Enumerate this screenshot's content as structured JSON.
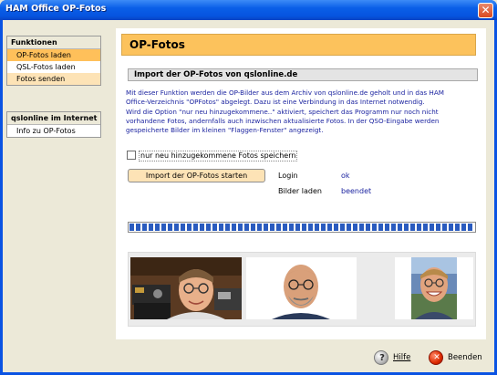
{
  "window": {
    "title": "HAM Office OP-Fotos",
    "close_glyph": "✕"
  },
  "sidebar": {
    "sections": [
      {
        "header": "Funktionen",
        "items": [
          {
            "label": "OP-Fotos laden",
            "active": true
          },
          {
            "label": "QSL-Fotos laden",
            "active": false
          },
          {
            "label": "Fotos senden",
            "active": false
          }
        ]
      },
      {
        "header": "qslonline im Internet",
        "items": [
          {
            "label": "Info zu OP-Fotos",
            "active": false
          }
        ]
      }
    ]
  },
  "main": {
    "title": "OP-Fotos",
    "section_title": "Import der OP-Fotos von qslonline.de",
    "description_lines": [
      "Mit dieser Funktion werden die OP-Bilder aus dem Archiv von qslonline.de geholt und in das HAM",
      "Office-Verzeichnis \"OPFotos\" abgelegt. Dazu ist eine Verbindung in das Internet notwendig.",
      " Wird die Option \"nur neu hinzugekommene..\" aktiviert, speichert das Programm nur noch nicht",
      "vorhandene Fotos, andernfalls auch inzwischen aktualisierte Fotos. In der QSO-Eingabe werden",
      "gespeicherte Bilder im kleinen \"Flaggen-Fenster\" angezeigt."
    ],
    "checkbox_label": "nur neu hinzugekommene Fotos speichern",
    "checkbox_checked": false,
    "start_button": "Import der OP-Fotos starten",
    "status": {
      "login_label": "Login",
      "login_value": "ok",
      "images_label": "Bilder laden",
      "images_value": "beendet"
    },
    "progress": 1.0
  },
  "footer": {
    "help_label": "Hilfe",
    "exit_label": "Beenden"
  },
  "colors": {
    "accent_orange": "#fcc25c",
    "nav_active": "#ffc05a",
    "text_blue": "#1c24a0",
    "progress_blue": "#2a5bbf"
  }
}
